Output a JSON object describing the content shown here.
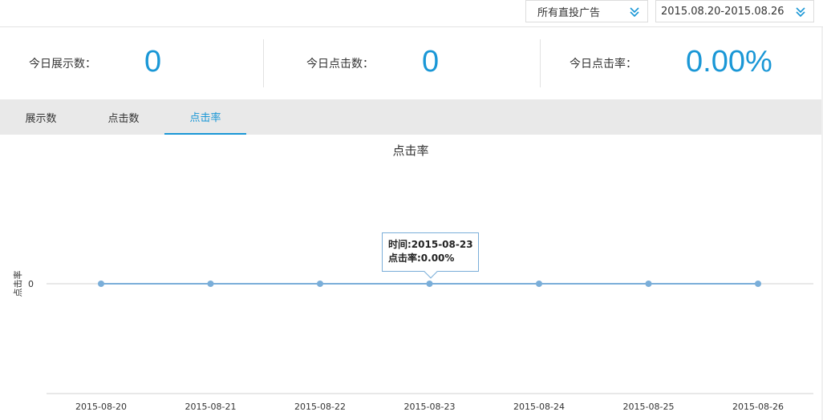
{
  "filters": {
    "ad_select": "所有直投广告",
    "date_range": "2015.08.20-2015.08.26"
  },
  "stats": {
    "impressions_label": "今日展示数：",
    "impressions_value": "0",
    "clicks_label": "今日点击数：",
    "clicks_value": "0",
    "ctr_label": "今日点击率：",
    "ctr_value": "0.00%"
  },
  "tabs": [
    {
      "label": "展示数",
      "active": false
    },
    {
      "label": "点击数",
      "active": false
    },
    {
      "label": "点击率",
      "active": true
    }
  ],
  "colors": {
    "accent": "#1a97d6",
    "series": "#7aaed9"
  },
  "tooltip": {
    "line1": "时间:2015-08-23",
    "line2": "点击率:0.00%"
  },
  "chart_data": {
    "type": "line",
    "title": "点击率",
    "ylabel": "点击率",
    "xlabel": "",
    "x": [
      "2015-08-20",
      "2015-08-21",
      "2015-08-22",
      "2015-08-23",
      "2015-08-24",
      "2015-08-25",
      "2015-08-26"
    ],
    "yticks": [
      "0"
    ],
    "series": [
      {
        "values": [
          0,
          0,
          0,
          0,
          0,
          0,
          0
        ]
      }
    ],
    "grid": false,
    "legend": "none"
  }
}
